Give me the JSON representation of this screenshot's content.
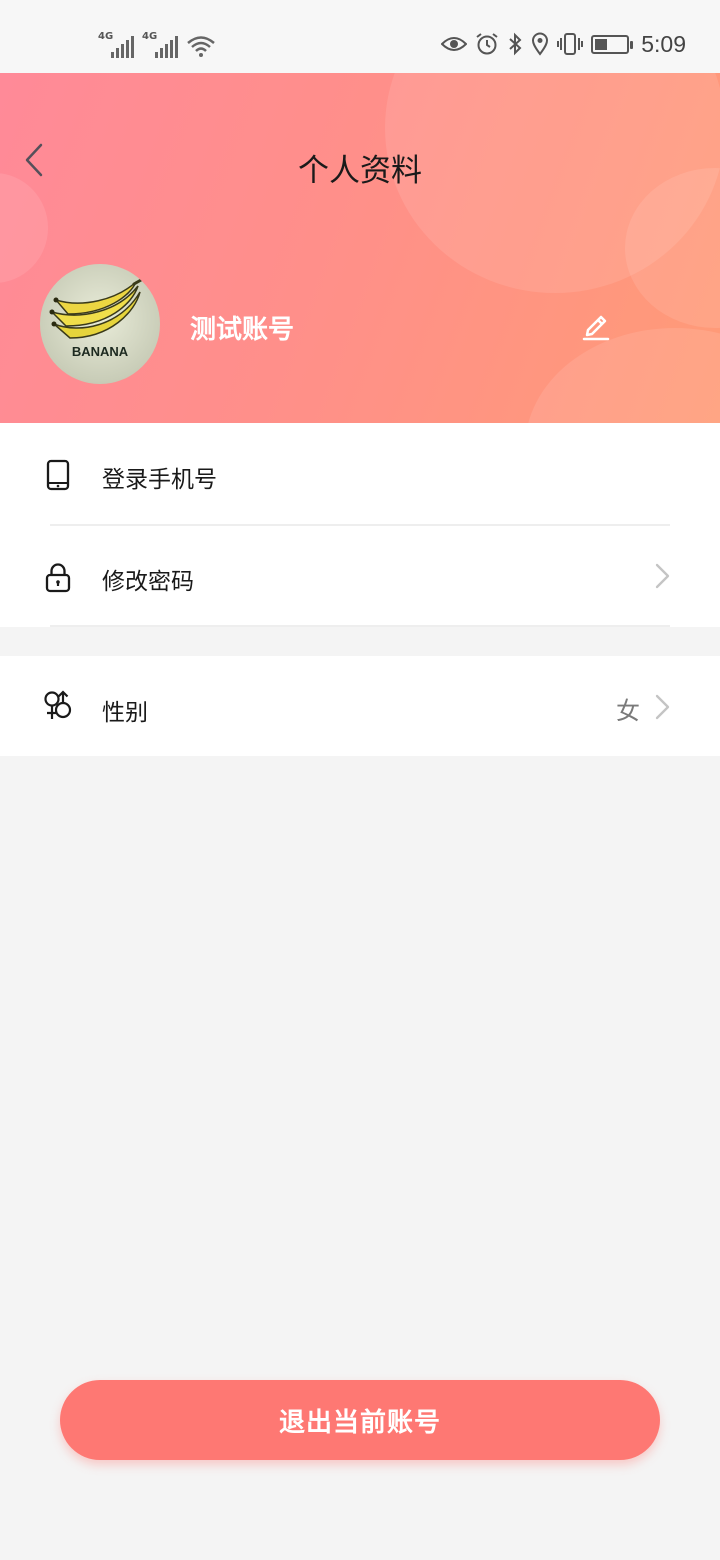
{
  "status_bar": {
    "network_1": "4G",
    "network_2": "4G",
    "time": "5:09",
    "icons": [
      "signal-icon",
      "signal-icon",
      "wifi-icon",
      "eye-icon",
      "alarm-icon",
      "bluetooth-icon",
      "location-icon",
      "vibrate-icon",
      "battery-icon"
    ],
    "battery_level": 0.35
  },
  "header": {
    "title": "个人资料",
    "avatar_text": "BANANA",
    "user_name": "测试账号",
    "gradient": [
      "#ff8a98",
      "#ff9b77"
    ]
  },
  "menu": {
    "phone_label": "登录手机号",
    "password_label": "修改密码",
    "gender_label": "性别",
    "gender_value": "女"
  },
  "logout": {
    "label": "退出当前账号",
    "color": "#fe7873"
  }
}
